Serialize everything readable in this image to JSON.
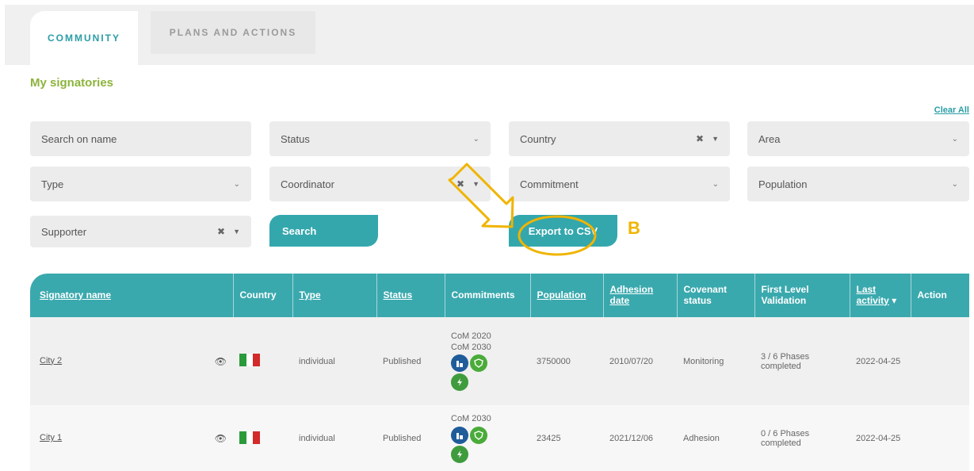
{
  "tabs": {
    "community": "COMMUNITY",
    "plans": "PLANS AND ACTIONS"
  },
  "page_title": "My signatories",
  "clear_all": "Clear All",
  "filters": {
    "search_placeholder": "Search on name",
    "status": "Status",
    "country": "Country",
    "area": "Area",
    "type": "Type",
    "coordinator": "Coordinator",
    "commitment": "Commitment",
    "population": "Population",
    "supporter": "Supporter"
  },
  "buttons": {
    "search": "Search",
    "export": "Export to CSV"
  },
  "annotation_label": "B",
  "table": {
    "headers": {
      "name": "Signatory name",
      "country": "Country",
      "type": "Type",
      "status": "Status",
      "commitments": "Commitments",
      "population": "Population",
      "adhesion_date": "Adhesion date",
      "covenant_status": "Covenant status",
      "first_level_validation": "First Level Validation",
      "last_activity": "Last activity",
      "action": "Action"
    },
    "rows": [
      {
        "name": "City 2",
        "country_flag": "italy",
        "type": "individual",
        "status": "Published",
        "commitments": [
          "CoM 2020",
          "CoM 2030"
        ],
        "population": "3750000",
        "adhesion_date": "2010/07/20",
        "covenant_status": "Monitoring",
        "validation": "3 / 6 Phases completed",
        "last_activity": "2022-04-25"
      },
      {
        "name": "City 1",
        "country_flag": "italy",
        "type": "individual",
        "status": "Published",
        "commitments": [
          "CoM 2030"
        ],
        "population": "23425",
        "adhesion_date": "2021/12/06",
        "covenant_status": "Adhesion",
        "validation": "0 / 6 Phases completed",
        "last_activity": "2022-04-25"
      }
    ]
  },
  "colors": {
    "accent": "#34a7ad",
    "title_green": "#8cb43c",
    "annotation": "#f0b400",
    "badge_blue": "#1f5c9a",
    "badge_green": "#4aab3a"
  }
}
